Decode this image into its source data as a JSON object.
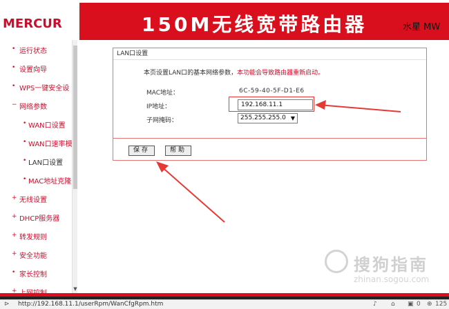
{
  "header": {
    "logo": "MERCUR",
    "title": "150M无线宽带路由器",
    "model": "水星 MW"
  },
  "sidebar": {
    "items": [
      {
        "label": "运行状态",
        "bullet": "•"
      },
      {
        "label": "设置向导",
        "bullet": "•"
      },
      {
        "label": "WPS一键安全设",
        "bullet": "•"
      },
      {
        "label": "网络参数",
        "bullet": "−"
      },
      {
        "label": "WAN口设置",
        "bullet": "•"
      },
      {
        "label": "WAN口速率模",
        "bullet": "•"
      },
      {
        "label": "LAN口设置",
        "bullet": "•"
      },
      {
        "label": "MAC地址克隆",
        "bullet": "•"
      },
      {
        "label": "无线设置",
        "bullet": "+"
      },
      {
        "label": "DHCP服务器",
        "bullet": "+"
      },
      {
        "label": "转发规则",
        "bullet": "+"
      },
      {
        "label": "安全功能",
        "bullet": "+"
      },
      {
        "label": "家长控制",
        "bullet": "•"
      },
      {
        "label": "上网控制",
        "bullet": "+"
      }
    ],
    "scroll_down": "▼"
  },
  "panel": {
    "title": "LAN口设置",
    "info_text": "本页设置LAN口的基本网络参数，",
    "info_warning": "本功能会导致路由器重新启动。",
    "mac_label": "MAC地址：",
    "mac_value": "6C-59-40-5F-D1-E6",
    "ip_label": "IP地址：",
    "ip_value": "192.168.11.1",
    "mask_label": "子网掩码：",
    "mask_value": "255.255.255.0",
    "mask_caret": "▼",
    "save_label": "保存",
    "help_label": "帮助"
  },
  "watermark": {
    "text": "搜狗指南",
    "url": "zhinan.sogou.com"
  },
  "statusbar": {
    "url": "http://192.168.11.1/userRpm/WanCfgRpm.htm",
    "icons": [
      "speaker-icon",
      "lock-icon",
      "download-icon",
      "zoom-icon"
    ],
    "download_count": "0",
    "zoom": "125"
  },
  "colors": {
    "brand_red": "#d90f1d",
    "nav_red": "#c8102e",
    "arrow_red": "#e53935"
  }
}
